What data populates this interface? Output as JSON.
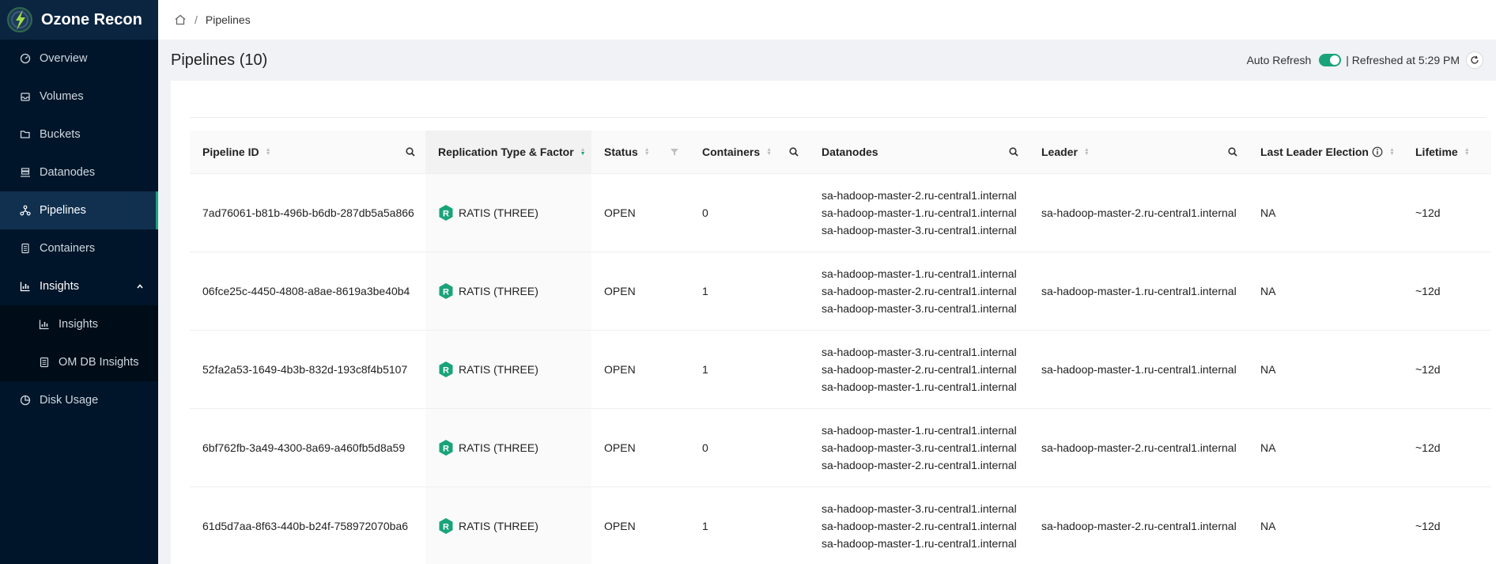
{
  "brand": {
    "name": "Ozone Recon"
  },
  "sidebar": {
    "items": [
      {
        "label": "Overview",
        "icon": "dashboard-icon"
      },
      {
        "label": "Volumes",
        "icon": "inbox-icon"
      },
      {
        "label": "Buckets",
        "icon": "folder-open-icon"
      },
      {
        "label": "Datanodes",
        "icon": "cluster-icon"
      },
      {
        "label": "Pipelines",
        "icon": "deployment-unit-icon",
        "active": true
      },
      {
        "label": "Containers",
        "icon": "container-icon"
      }
    ],
    "insights": {
      "label": "Insights",
      "children": [
        {
          "label": "Insights"
        },
        {
          "label": "OM DB Insights"
        }
      ]
    },
    "disk_usage": {
      "label": "Disk Usage"
    }
  },
  "breadcrumb": {
    "current": "Pipelines",
    "separator": "/"
  },
  "header": {
    "title": "Pipelines (10)",
    "auto_refresh_label": "Auto Refresh",
    "refreshed_text": "| Refreshed at 5:29 PM"
  },
  "table": {
    "columns": [
      "Pipeline ID",
      "Replication Type & Factor",
      "Status",
      "Containers",
      "Datanodes",
      "Leader",
      "Last Leader Election",
      "Lifetime"
    ],
    "rows": [
      {
        "id": "7ad76061-b81b-496b-b6db-287db5a5a866",
        "replication": "RATIS (THREE)",
        "status": "OPEN",
        "containers": "0",
        "datanodes": [
          "sa-hadoop-master-2.ru-central1.internal",
          "sa-hadoop-master-1.ru-central1.internal",
          "sa-hadoop-master-3.ru-central1.internal"
        ],
        "leader": "sa-hadoop-master-2.ru-central1.internal",
        "last_election": "NA",
        "lifetime": "~12d"
      },
      {
        "id": "06fce25c-4450-4808-a8ae-8619a3be40b4",
        "replication": "RATIS (THREE)",
        "status": "OPEN",
        "containers": "1",
        "datanodes": [
          "sa-hadoop-master-1.ru-central1.internal",
          "sa-hadoop-master-2.ru-central1.internal",
          "sa-hadoop-master-3.ru-central1.internal"
        ],
        "leader": "sa-hadoop-master-1.ru-central1.internal",
        "last_election": "NA",
        "lifetime": "~12d"
      },
      {
        "id": "52fa2a53-1649-4b3b-832d-193c8f4b5107",
        "replication": "RATIS (THREE)",
        "status": "OPEN",
        "containers": "1",
        "datanodes": [
          "sa-hadoop-master-3.ru-central1.internal",
          "sa-hadoop-master-2.ru-central1.internal",
          "sa-hadoop-master-1.ru-central1.internal"
        ],
        "leader": "sa-hadoop-master-1.ru-central1.internal",
        "last_election": "NA",
        "lifetime": "~12d"
      },
      {
        "id": "6bf762fb-3a49-4300-8a69-a460fb5d8a59",
        "replication": "RATIS (THREE)",
        "status": "OPEN",
        "containers": "0",
        "datanodes": [
          "sa-hadoop-master-1.ru-central1.internal",
          "sa-hadoop-master-3.ru-central1.internal",
          "sa-hadoop-master-2.ru-central1.internal"
        ],
        "leader": "sa-hadoop-master-2.ru-central1.internal",
        "last_election": "NA",
        "lifetime": "~12d"
      },
      {
        "id": "61d5d7aa-8f63-440b-b24f-758972070ba6",
        "replication": "RATIS (THREE)",
        "status": "OPEN",
        "containers": "1",
        "datanodes": [
          "sa-hadoop-master-3.ru-central1.internal",
          "sa-hadoop-master-2.ru-central1.internal",
          "sa-hadoop-master-1.ru-central1.internal"
        ],
        "leader": "sa-hadoop-master-2.ru-central1.internal",
        "last_election": "NA",
        "lifetime": "~12d"
      }
    ]
  },
  "colors": {
    "sidebar_bg": "#001529",
    "accent": "#1aa37a"
  }
}
